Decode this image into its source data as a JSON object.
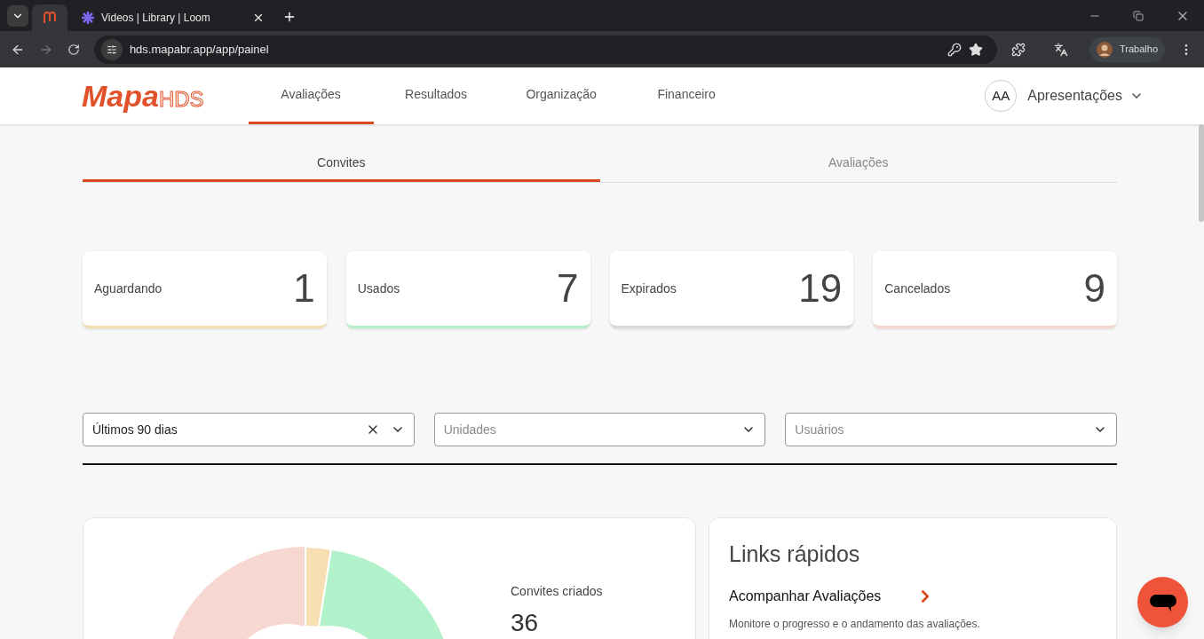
{
  "browser": {
    "tabs": [
      {
        "selected": true
      },
      {
        "title": "Videos | Library | Loom",
        "selected": false
      }
    ],
    "url": "hds.mapabr.app/app/painel",
    "profile": "Trabalho"
  },
  "header": {
    "logo_main": "Mapa",
    "logo_suffix": "HDS",
    "nav": [
      {
        "label": "Avaliações",
        "selected": true
      },
      {
        "label": "Resultados",
        "selected": false
      },
      {
        "label": "Organização",
        "selected": false
      },
      {
        "label": "Financeiro",
        "selected": false
      }
    ],
    "avatar": "AA",
    "account": "Apresentações"
  },
  "subtabs": [
    {
      "label": "Convites",
      "selected": true
    },
    {
      "label": "Avaliações",
      "selected": false
    }
  ],
  "stats": [
    {
      "label": "Aguardando",
      "value": "1",
      "color": "#f5deb0"
    },
    {
      "label": "Usados",
      "value": "7",
      "color": "#b3efca"
    },
    {
      "label": "Expirados",
      "value": "19",
      "color": "#d9d9d9"
    },
    {
      "label": "Cancelados",
      "value": "9",
      "color": "#f6d5cf"
    }
  ],
  "filters": [
    {
      "value": "Últimos 90 dias",
      "clearable": true
    },
    {
      "placeholder": "Unidades",
      "clearable": false
    },
    {
      "placeholder": "Usuários",
      "clearable": false
    }
  ],
  "summary": {
    "label": "Convites criados",
    "value": "36"
  },
  "quick_links": {
    "title": "Links rápidos",
    "items": [
      {
        "label": "Acompanhar Avaliações",
        "description": "Monitore o progresso e o andamento das avaliações."
      }
    ]
  }
}
